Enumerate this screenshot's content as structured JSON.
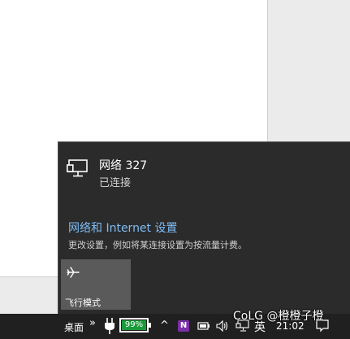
{
  "network_flyout": {
    "network_name": "网络 327",
    "network_status": "已连接",
    "settings_link": "网络和 Internet 设置",
    "settings_description": "更改设置，例如将某连接设置为按流量计费。",
    "airplane_tile_label": "飞行模式",
    "network_icon": "ethernet-monitor-icon",
    "airplane_icon": "airplane-icon"
  },
  "taskbar": {
    "desktop_label": "桌面",
    "overflow_chevron": "»",
    "battery_percent": "99%",
    "battery_level": 0.99,
    "tray_expand": "^",
    "onenote_letter": "N",
    "ime_label": "英",
    "clock_time": "21:02"
  },
  "watermark": {
    "text": "CoLG @橙橙子橙"
  },
  "colors": {
    "flyout_bg": "#2b2b2b",
    "link_blue": "#7fbcf5",
    "tile_bg": "#5a5a5a",
    "taskbar_bg": "#202020",
    "battery_green": "#1a9a3a",
    "onenote_purple": "#7b2fa8"
  }
}
